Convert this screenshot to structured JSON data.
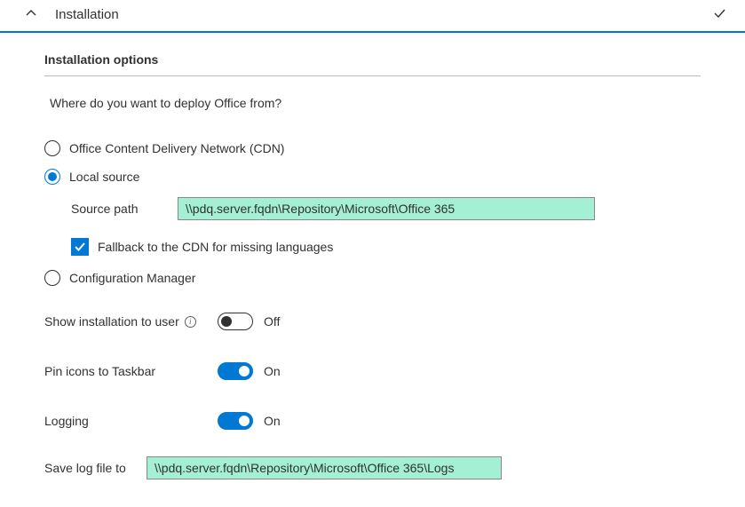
{
  "header": {
    "title": "Installation"
  },
  "section": {
    "subheading": "Installation options",
    "prompt": "Where do you want to deploy Office from?"
  },
  "radios": {
    "cdn": "Office Content Delivery Network (CDN)",
    "local": "Local source",
    "configmgr": "Configuration Manager"
  },
  "source": {
    "label": "Source path",
    "value": "\\\\pdq.server.fqdn\\Repository\\Microsoft\\Office 365"
  },
  "fallback": {
    "label": "Fallback to the CDN for missing languages"
  },
  "toggles": {
    "show_install": {
      "label": "Show installation to user",
      "state": "Off"
    },
    "pin_icons": {
      "label": "Pin icons to Taskbar",
      "state": "On"
    },
    "logging": {
      "label": "Logging",
      "state": "On"
    }
  },
  "savelog": {
    "label": "Save log file to",
    "value": "\\\\pdq.server.fqdn\\Repository\\Microsoft\\Office 365\\Logs"
  }
}
